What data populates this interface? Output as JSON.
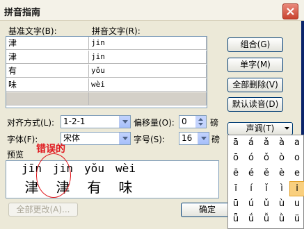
{
  "window": {
    "title": "拼音指南",
    "close_label": "✕"
  },
  "headers": {
    "base_text": "基准文字(B):",
    "pinyin_text": "拼音文字(R):"
  },
  "rows": [
    {
      "base": "津",
      "pinyin": "jin"
    },
    {
      "base": "津",
      "pinyin": "jin"
    },
    {
      "base": "有",
      "pinyin": "yǒu"
    },
    {
      "base": "味",
      "pinyin": "wèi"
    },
    {
      "base": "",
      "pinyin": ""
    }
  ],
  "buttons": {
    "combine": "组合(G)",
    "single": "单字(M)",
    "clear_all": "全部删除(V)",
    "default_reading": "默认读音(D)",
    "tone": "声调(T)",
    "change_all": "全部更改(A)...",
    "ok": "确定"
  },
  "fields": {
    "align_label": "对齐方式(L):",
    "align_value": "1-2-1",
    "offset_label": "偏移量(O):",
    "offset_value": "0",
    "offset_unit": "磅",
    "font_label": "字体(F):",
    "font_value": "宋体",
    "size_label": "字号(S):",
    "size_value": "16",
    "size_unit": "磅"
  },
  "preview": {
    "label": "预览",
    "pinyin": [
      "jīn",
      "jin",
      "yǒu",
      "wèi"
    ],
    "chars": [
      "津",
      "津",
      "有",
      "味"
    ]
  },
  "annotation": {
    "text": "错误的"
  },
  "tone_grid": [
    [
      "ā",
      "á",
      "ǎ",
      "à",
      "a"
    ],
    [
      "ō",
      "ó",
      "ǒ",
      "ò",
      "o"
    ],
    [
      "ē",
      "é",
      "ě",
      "è",
      "e"
    ],
    [
      "ī",
      "í",
      "ǐ",
      "ì",
      "i"
    ],
    [
      "ū",
      "ú",
      "ǔ",
      "ù",
      "u"
    ],
    [
      "ǖ",
      "ǘ",
      "ǚ",
      "ǜ",
      "ü"
    ]
  ],
  "tone_selected": "i"
}
